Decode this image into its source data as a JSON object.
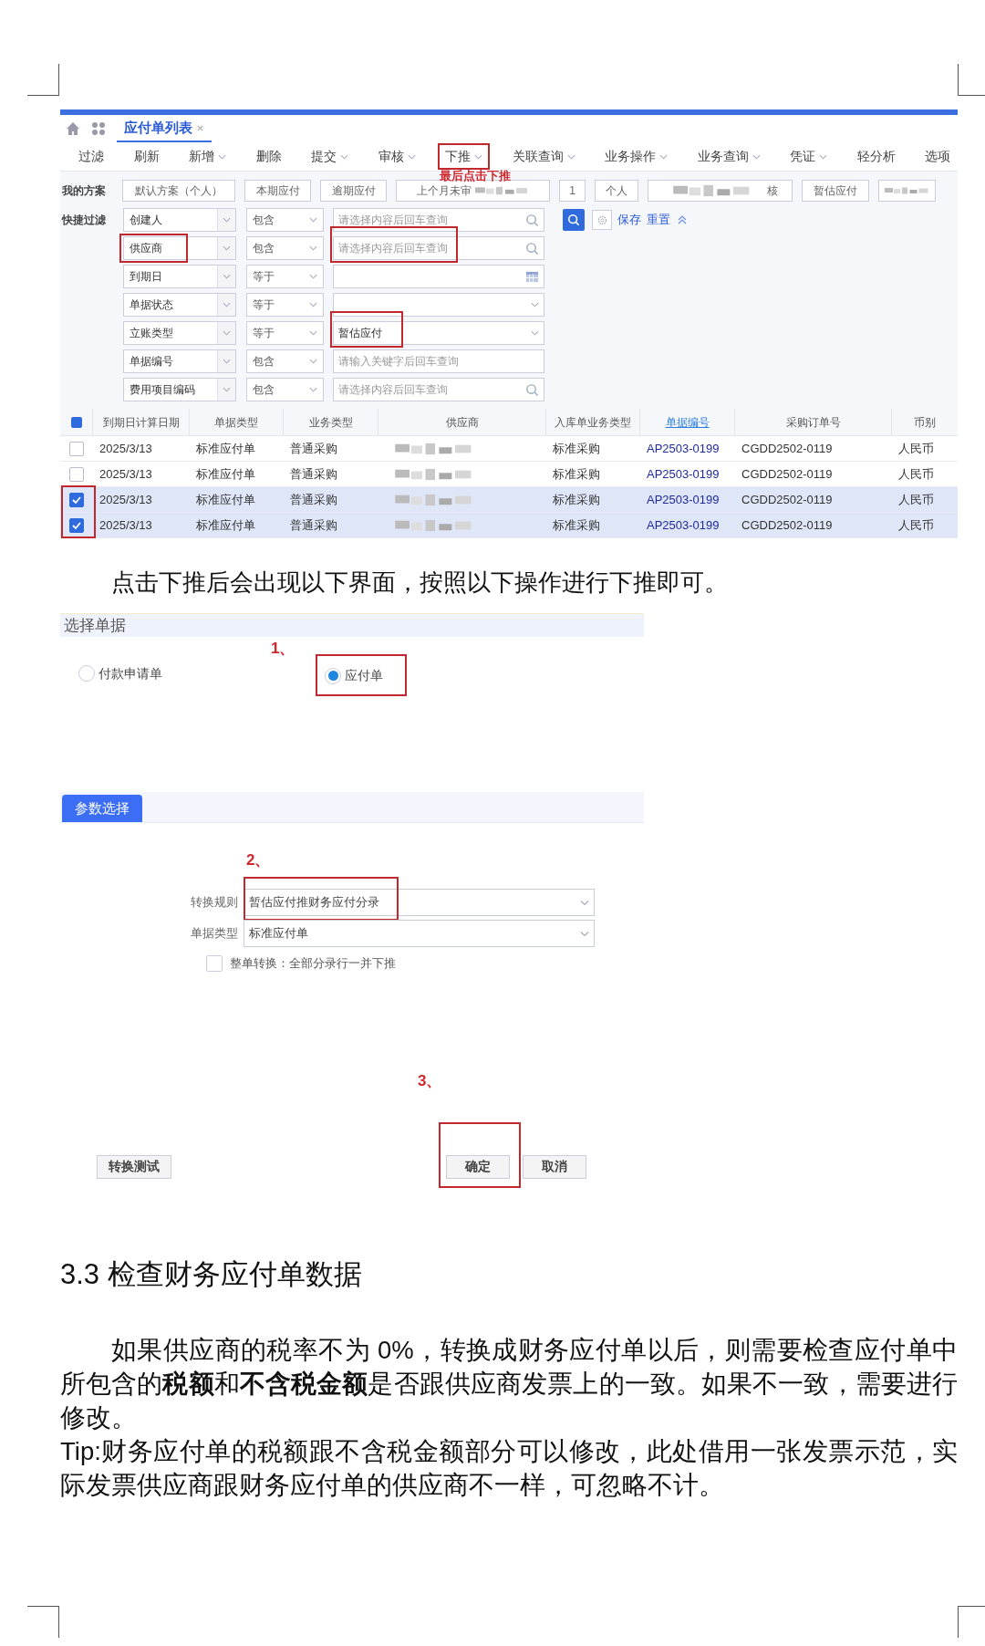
{
  "tabs": [
    {
      "label": "应付单列表",
      "selected": true
    }
  ],
  "toolbar": [
    {
      "label": "过滤",
      "dropdown": false,
      "annotated": false
    },
    {
      "label": "刷新",
      "dropdown": false,
      "annotated": false
    },
    {
      "label": "新增",
      "dropdown": true,
      "annotated": false
    },
    {
      "label": "删除",
      "dropdown": false,
      "annotated": false
    },
    {
      "label": "提交",
      "dropdown": true,
      "annotated": false
    },
    {
      "label": "审核",
      "dropdown": true,
      "annotated": false
    },
    {
      "label": "下推",
      "dropdown": true,
      "annotated": true
    },
    {
      "label": "关联查询",
      "dropdown": true,
      "annotated": false
    },
    {
      "label": "业务操作",
      "dropdown": true,
      "annotated": false
    },
    {
      "label": "业务查询",
      "dropdown": true,
      "annotated": false
    },
    {
      "label": "凭证",
      "dropdown": true,
      "annotated": false
    },
    {
      "label": "轻分析",
      "dropdown": false,
      "annotated": false
    },
    {
      "label": "选项",
      "dropdown": false,
      "annotated": false
    }
  ],
  "toolbar_note": "最后点击下推",
  "plans": {
    "label": "我的方案",
    "items": [
      {
        "text": "默认方案（个人）",
        "kind": "plain"
      },
      {
        "text": "本期应付",
        "kind": "plain"
      },
      {
        "text": "逾期应付",
        "kind": "plain"
      },
      {
        "text": "上个月未审",
        "kind": "tailblurred"
      },
      {
        "text": "1",
        "kind": "plain"
      },
      {
        "text": "个人",
        "kind": "plain"
      },
      {
        "text": "核",
        "kind": "headblurred"
      },
      {
        "text": "暂估应付",
        "kind": "plain"
      },
      {
        "kind": "blurred"
      }
    ]
  },
  "quick_filter": {
    "label": "快捷过滤",
    "links": [
      "保存",
      "重置"
    ],
    "rows": [
      {
        "field": "创建人",
        "operator": "包含",
        "placeholder": "请选择内容后回车查询",
        "kind": "search",
        "field_annotated": false,
        "value_annotated": false
      },
      {
        "field": "供应商",
        "operator": "包含",
        "placeholder": "请选择内容后回车查询",
        "kind": "search",
        "field_annotated": true,
        "value_annotated": true
      },
      {
        "field": "到期日",
        "operator": "等于",
        "kind": "date",
        "field_annotated": false,
        "value_annotated": false
      },
      {
        "field": "单据状态",
        "operator": "等于",
        "kind": "select",
        "field_annotated": false,
        "value_annotated": false
      },
      {
        "field": "立账类型",
        "operator": "等于",
        "value": "暂估应付",
        "kind": "select",
        "field_annotated": false,
        "value_annotated": true
      },
      {
        "field": "单据编号",
        "operator": "包含",
        "placeholder": "请输入关键字后回车查询",
        "kind": "text",
        "field_annotated": false,
        "value_annotated": false
      },
      {
        "field": "费用项目编码",
        "operator": "包含",
        "placeholder": "请选择内容后回车查询",
        "kind": "search",
        "field_annotated": false,
        "value_annotated": false
      }
    ]
  },
  "table": {
    "header_checked": true,
    "columns": [
      {
        "label": "到期日计算日期",
        "kind": "text"
      },
      {
        "label": "单据类型",
        "kind": "text"
      },
      {
        "label": "业务类型",
        "kind": "text"
      },
      {
        "label": "供应商",
        "kind": "blurred"
      },
      {
        "label": "入库单业务类型",
        "kind": "text"
      },
      {
        "label": "单据编号",
        "kind": "link"
      },
      {
        "label": "采购订单号",
        "kind": "text"
      },
      {
        "label": "币别",
        "kind": "text"
      }
    ],
    "rows": [
      {
        "checked": false,
        "annotated": false,
        "cells": [
          "2025/3/13",
          "标准应付单",
          "普通采购",
          "",
          "标准采购",
          "AP2503-0199",
          "CGDD2502-0119",
          "人民币"
        ]
      },
      {
        "checked": false,
        "annotated": false,
        "cells": [
          "2025/3/13",
          "标准应付单",
          "普通采购",
          "",
          "标准采购",
          "AP2503-0199",
          "CGDD2502-0119",
          "人民币"
        ]
      },
      {
        "checked": true,
        "annotated": true,
        "cells": [
          "2025/3/13",
          "标准应付单",
          "普通采购",
          "",
          "标准采购",
          "AP2503-0199",
          "CGDD2502-0119",
          "人民币"
        ]
      },
      {
        "checked": true,
        "annotated": true,
        "cells": [
          "2025/3/13",
          "标准应付单",
          "普通采购",
          "",
          "标准采购",
          "AP2503-0199",
          "CGDD2502-0119",
          "人民币"
        ]
      }
    ]
  },
  "intro": "点击下推后会出现以下界面，按照以下操作进行下推即可。",
  "dialog": {
    "section_title": "选择单据",
    "steps": [
      "1、",
      "2、",
      "3、"
    ],
    "radios": [
      {
        "label": "付款申请单",
        "selected": false,
        "annotated": false
      },
      {
        "label": "应付单",
        "selected": true,
        "annotated": true
      }
    ],
    "param_tab": {
      "label": "参数选择",
      "selected": true
    },
    "fields": [
      {
        "label": "转换规则",
        "value": "暂估应付推财务应付分录",
        "annotated": true
      },
      {
        "label": "单据类型",
        "value": "标准应付单",
        "annotated": false
      }
    ],
    "checkbox": {
      "label": "整单转换：全部分录行一并下推",
      "checked": false
    },
    "buttons": [
      {
        "label": "转换测试",
        "annotated": false
      },
      {
        "label": "确定",
        "annotated": true
      },
      {
        "label": "取消",
        "annotated": false
      }
    ]
  },
  "heading": "3.3 检查财务应付单数据",
  "paragraphs": [
    {
      "text": "如果供应商的税率不为 0%，转换成财务应付单以后，则需要检查应付单中所包含的**税额**和**不含税金额**是否跟供应商发票上的一致。如果不一致，需要进行修改。",
      "indent": true
    },
    {
      "text": "Tip:财务应付单的税额跟不含税金额部分可以修改，此处借用一张发票示范，实际发票供应商跟财务应付单的供应商不一样，可忽略不计。",
      "indent": false
    }
  ]
}
